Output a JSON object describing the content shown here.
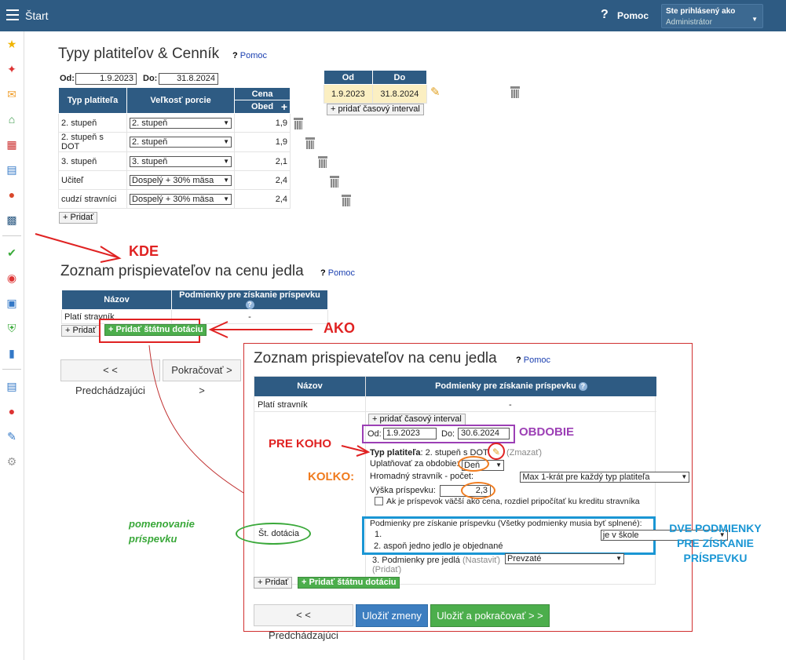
{
  "topbar": {
    "title": "Štart",
    "help": "Pomoc",
    "user_label": "Ste prihlásený ako",
    "user_value": "Administrátor"
  },
  "section1": {
    "title": "Typy platiteľov & Cenník",
    "help": "Pomoc",
    "od_label": "Od:",
    "od_value": "1.9.2023",
    "do_label": "Do:",
    "do_value": "31.8.2024",
    "headers": {
      "typ": "Typ platiteľa",
      "porcia": "Veľkosť porcie",
      "cena": "Cena",
      "obed": "Obed"
    },
    "rows": [
      {
        "typ": "2. stupeň",
        "porcia": "2. stupeň",
        "cena": "1,9"
      },
      {
        "typ": "2. stupeň  s DOT",
        "porcia": "2. stupeň",
        "cena": "1,9"
      },
      {
        "typ": "3. stupeň",
        "porcia": "3. stupeň",
        "cena": "2,1"
      },
      {
        "typ": "Učiteľ",
        "porcia": "Dospelý + 30% mäsa",
        "cena": "2,4"
      },
      {
        "typ": "cudzí stravníci",
        "porcia": "Dospelý + 30% mäsa",
        "cena": "2,4"
      }
    ],
    "add": "+ Pridať"
  },
  "interval": {
    "od": "Od",
    "do": "Do",
    "od_value": "1.9.2023",
    "do_value": "31.8.2024",
    "add": "+ pridať časový interval"
  },
  "annot": {
    "kde": "KDE",
    "ako": "AKO",
    "pre_koho": "PRE KOHO",
    "obdobie": "OBDOBIE",
    "kolko": "KOĽKO:",
    "pomenovanie1": "pomenovanie",
    "pomenovanie2": "príspevku",
    "dve1": "DVE PODMIENKY",
    "dve2": "PRE ZÍSKANIE",
    "dve3": "PRÍSPEVKU"
  },
  "section2": {
    "title": "Zoznam prispievateľov na cenu jedla",
    "help": "Pomoc",
    "col_nazov": "Názov",
    "col_podm": "Podmienky pre získanie príspevku",
    "row1": "Platí stravník",
    "row1_val": "-",
    "add": "+ Pridať",
    "add_state": "+ Pridať štátnu dotáciu",
    "prev": "< < Predchádzajúci",
    "next": "Pokračovať > >"
  },
  "detail": {
    "title": "Zoznam prispievateľov na cenu jedla",
    "help": "Pomoc",
    "col_nazov": "Názov",
    "col_podm": "Podmienky pre získanie príspevku",
    "row1": "Platí stravník",
    "row1_val": "-",
    "add_interval": "+ pridať časový interval",
    "od_label": "Od:",
    "od_value": "1.9.2023",
    "do_label": "Do:",
    "do_value": "30.6.2024",
    "typ_label": "Typ platiteľa",
    "typ_value": ": 2. stupeň  s DOT",
    "zmazat": "(Zmazať)",
    "uplat_label": "Uplatňovať za obdobie:",
    "uplat_value": "Deň",
    "hrom_label": "Hromadný stravník - počet:",
    "hrom_value": "Max 1-krát pre každý typ platiteľa",
    "vyska_label": "Výška príspevku:",
    "vyska_value": "2,3",
    "check_label": "Ak je príspevok väčší ako cena, rozdiel pripočítať ku kreditu stravníka",
    "row2_name": "Št. dotácia",
    "podm_title": "Podmienky pre získanie príspevku (Všetky podmienky musia byť splnené):",
    "p1_num": "1.",
    "p1_value": "je v škole",
    "p2_label": "2. aspoň jedno jedlo je objednané",
    "p2_value": "Prevzaté",
    "p3_label": "3. Podmienky pre jedlá",
    "p3_link": "(Nastaviť)",
    "pridat_link": "(Pridať)",
    "add": "+ Pridať",
    "add_state": "+ Pridať štátnu dotáciu",
    "prev": "< < Predchádzajúci",
    "save": "Uložiť zmeny",
    "save_next": "Uložiť a pokračovať > >"
  }
}
